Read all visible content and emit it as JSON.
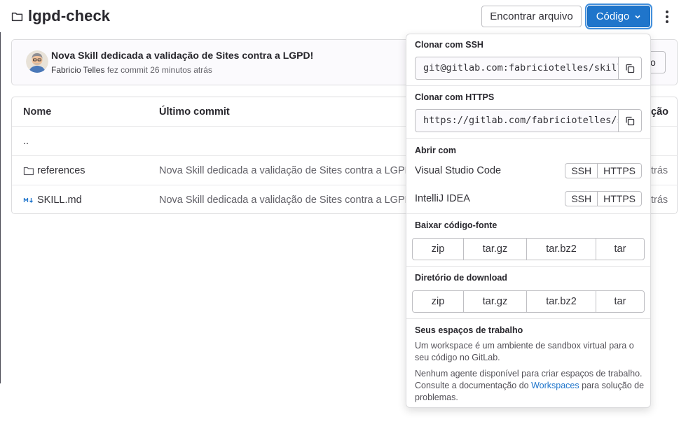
{
  "repo": {
    "title": "lgpd-check"
  },
  "header": {
    "find_file": "Encontrar arquivo",
    "code": "Código"
  },
  "commit": {
    "title": "Nova Skill dedicada a validação de Sites contra a LGPD!",
    "author": "Fabricio Telles",
    "action": "fez commit",
    "time": "26 minutos atrás",
    "hidden_button_fragment": "o"
  },
  "table": {
    "headers": {
      "name": "Nome",
      "last_commit": "Último commit",
      "last_update_fragment": "ção"
    },
    "rows": [
      {
        "name": "..",
        "message": "",
        "date": ""
      },
      {
        "name": "references",
        "message": "Nova Skill dedicada a validação de Sites contra a LGPD!",
        "date": "trás"
      },
      {
        "name": "SKILL.md",
        "message": "Nova Skill dedicada a validação de Sites contra a LGPD!",
        "date": "trás"
      }
    ]
  },
  "dropdown": {
    "ssh_title": "Clonar com SSH",
    "ssh_url": "git@gitlab.com:fabriciotelles/skills",
    "https_title": "Clonar com HTTPS",
    "https_url": "https://gitlab.com/fabriciotelles/skills.git",
    "open_with_title": "Abrir com",
    "ides": [
      {
        "label": "Visual Studio Code",
        "ssh": "SSH",
        "https": "HTTPS"
      },
      {
        "label": "IntelliJ IDEA",
        "ssh": "SSH",
        "https": "HTTPS"
      }
    ],
    "download_source_title": "Baixar código-fonte",
    "download_source_formats": [
      "zip",
      "tar.gz",
      "tar.bz2",
      "tar"
    ],
    "download_dir_title": "Diretório de download",
    "download_dir_formats": [
      "zip",
      "tar.gz",
      "tar.bz2",
      "tar"
    ],
    "workspaces_title": "Seus espaços de trabalho",
    "workspaces_desc": "Um workspace é um ambiente de sandbox virtual para o seu código no GitLab.",
    "workspaces_note_before": "Nenhum agente disponível para criar espaços de trabalho. Consulte a documentação do ",
    "workspaces_link": "Workspaces",
    "workspaces_note_after": " para solução de problemas."
  },
  "colors": {
    "accent": "#1f75cb",
    "text": "#333238",
    "muted": "#626168",
    "border": "#dcdcde"
  },
  "icons": {
    "folder": "folder-icon",
    "markdown": "markdown-icon",
    "copy": "copy-icon",
    "chevron": "chevron-down-icon",
    "kebab": "kebab-icon"
  }
}
